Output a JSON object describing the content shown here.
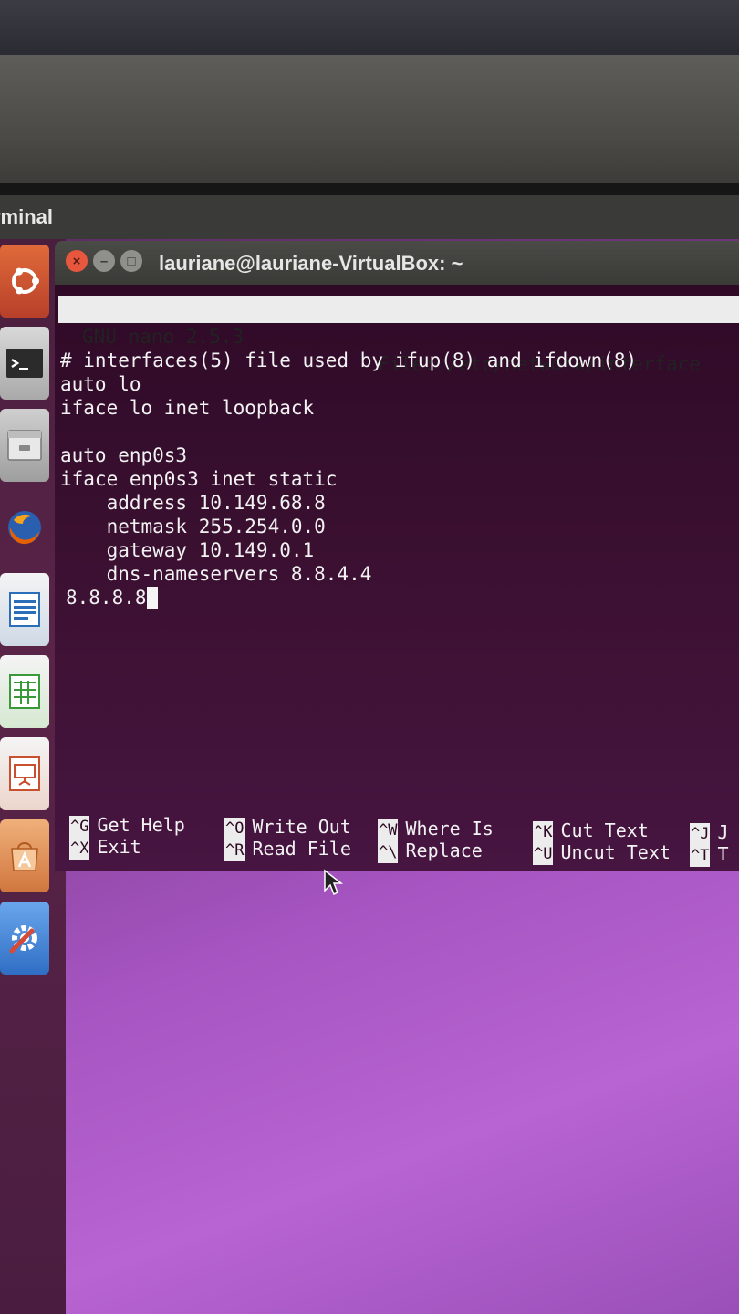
{
  "top_panel": {
    "app_name": "rminal"
  },
  "window": {
    "title": "lauriane@lauriane-VirtualBox: ~",
    "buttons": {
      "close": "×",
      "minimize": "–",
      "maximize": "□"
    }
  },
  "nano": {
    "version_label": "GNU nano 2.5.3",
    "file_label": "File: /etc/network/interface",
    "lines": [
      "# interfaces(5) file used by ifup(8) and ifdown(8)",
      "auto lo",
      "iface lo inet loopback",
      "",
      "auto enp0s3",
      "iface enp0s3 inet static",
      "    address 10.149.68.8",
      "    netmask 255.254.0.0",
      "    gateway 10.149.0.1",
      "    dns-nameservers 8.8.4.4",
      "8.8.8.8"
    ],
    "shortcuts": [
      {
        "key": "^G",
        "label": "Get Help"
      },
      {
        "key": "^X",
        "label": "Exit"
      },
      {
        "key": "^O",
        "label": "Write Out"
      },
      {
        "key": "^R",
        "label": "Read File"
      },
      {
        "key": "^W",
        "label": "Where Is"
      },
      {
        "key": "^\\",
        "label": "Replace"
      },
      {
        "key": "^K",
        "label": "Cut Text"
      },
      {
        "key": "^U",
        "label": "Uncut Text"
      },
      {
        "key": "^J",
        "label": "J"
      },
      {
        "key": "^T",
        "label": "T"
      }
    ]
  },
  "launcher": {
    "items": [
      {
        "name": "ubuntu-dash-icon",
        "color": "#dd4814"
      },
      {
        "name": "terminal-icon",
        "color": "#2b2b2b"
      },
      {
        "name": "files-icon",
        "color": "#a8a8a8"
      },
      {
        "name": "firefox-icon",
        "color": "#e66000"
      },
      {
        "name": "libreoffice-writer-icon",
        "color": "#2a6fb8"
      },
      {
        "name": "libreoffice-calc-icon",
        "color": "#3a9a3a"
      },
      {
        "name": "libreoffice-impress-icon",
        "color": "#c8502e"
      },
      {
        "name": "software-center-icon",
        "color": "#e38a4c"
      },
      {
        "name": "system-settings-icon",
        "color": "#4a8ad8"
      }
    ]
  }
}
